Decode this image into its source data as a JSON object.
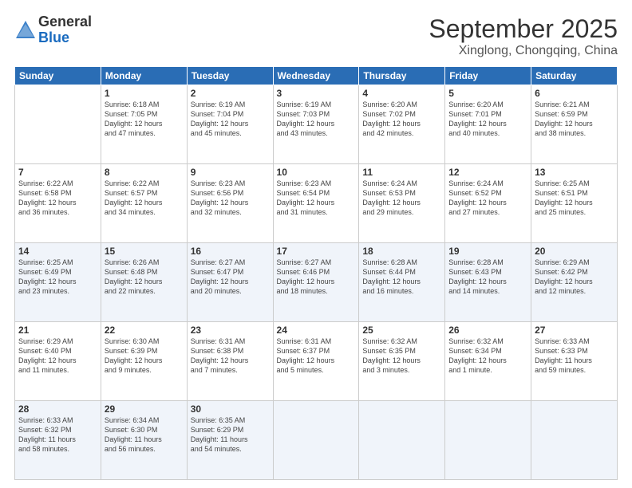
{
  "header": {
    "logo_general": "General",
    "logo_blue": "Blue",
    "month": "September 2025",
    "location": "Xinglong, Chongqing, China"
  },
  "days_of_week": [
    "Sunday",
    "Monday",
    "Tuesday",
    "Wednesday",
    "Thursday",
    "Friday",
    "Saturday"
  ],
  "weeks": [
    [
      {
        "day": "",
        "info": ""
      },
      {
        "day": "1",
        "info": "Sunrise: 6:18 AM\nSunset: 7:05 PM\nDaylight: 12 hours\nand 47 minutes."
      },
      {
        "day": "2",
        "info": "Sunrise: 6:19 AM\nSunset: 7:04 PM\nDaylight: 12 hours\nand 45 minutes."
      },
      {
        "day": "3",
        "info": "Sunrise: 6:19 AM\nSunset: 7:03 PM\nDaylight: 12 hours\nand 43 minutes."
      },
      {
        "day": "4",
        "info": "Sunrise: 6:20 AM\nSunset: 7:02 PM\nDaylight: 12 hours\nand 42 minutes."
      },
      {
        "day": "5",
        "info": "Sunrise: 6:20 AM\nSunset: 7:01 PM\nDaylight: 12 hours\nand 40 minutes."
      },
      {
        "day": "6",
        "info": "Sunrise: 6:21 AM\nSunset: 6:59 PM\nDaylight: 12 hours\nand 38 minutes."
      }
    ],
    [
      {
        "day": "7",
        "info": "Sunrise: 6:22 AM\nSunset: 6:58 PM\nDaylight: 12 hours\nand 36 minutes."
      },
      {
        "day": "8",
        "info": "Sunrise: 6:22 AM\nSunset: 6:57 PM\nDaylight: 12 hours\nand 34 minutes."
      },
      {
        "day": "9",
        "info": "Sunrise: 6:23 AM\nSunset: 6:56 PM\nDaylight: 12 hours\nand 32 minutes."
      },
      {
        "day": "10",
        "info": "Sunrise: 6:23 AM\nSunset: 6:54 PM\nDaylight: 12 hours\nand 31 minutes."
      },
      {
        "day": "11",
        "info": "Sunrise: 6:24 AM\nSunset: 6:53 PM\nDaylight: 12 hours\nand 29 minutes."
      },
      {
        "day": "12",
        "info": "Sunrise: 6:24 AM\nSunset: 6:52 PM\nDaylight: 12 hours\nand 27 minutes."
      },
      {
        "day": "13",
        "info": "Sunrise: 6:25 AM\nSunset: 6:51 PM\nDaylight: 12 hours\nand 25 minutes."
      }
    ],
    [
      {
        "day": "14",
        "info": "Sunrise: 6:25 AM\nSunset: 6:49 PM\nDaylight: 12 hours\nand 23 minutes."
      },
      {
        "day": "15",
        "info": "Sunrise: 6:26 AM\nSunset: 6:48 PM\nDaylight: 12 hours\nand 22 minutes."
      },
      {
        "day": "16",
        "info": "Sunrise: 6:27 AM\nSunset: 6:47 PM\nDaylight: 12 hours\nand 20 minutes."
      },
      {
        "day": "17",
        "info": "Sunrise: 6:27 AM\nSunset: 6:46 PM\nDaylight: 12 hours\nand 18 minutes."
      },
      {
        "day": "18",
        "info": "Sunrise: 6:28 AM\nSunset: 6:44 PM\nDaylight: 12 hours\nand 16 minutes."
      },
      {
        "day": "19",
        "info": "Sunrise: 6:28 AM\nSunset: 6:43 PM\nDaylight: 12 hours\nand 14 minutes."
      },
      {
        "day": "20",
        "info": "Sunrise: 6:29 AM\nSunset: 6:42 PM\nDaylight: 12 hours\nand 12 minutes."
      }
    ],
    [
      {
        "day": "21",
        "info": "Sunrise: 6:29 AM\nSunset: 6:40 PM\nDaylight: 12 hours\nand 11 minutes."
      },
      {
        "day": "22",
        "info": "Sunrise: 6:30 AM\nSunset: 6:39 PM\nDaylight: 12 hours\nand 9 minutes."
      },
      {
        "day": "23",
        "info": "Sunrise: 6:31 AM\nSunset: 6:38 PM\nDaylight: 12 hours\nand 7 minutes."
      },
      {
        "day": "24",
        "info": "Sunrise: 6:31 AM\nSunset: 6:37 PM\nDaylight: 12 hours\nand 5 minutes."
      },
      {
        "day": "25",
        "info": "Sunrise: 6:32 AM\nSunset: 6:35 PM\nDaylight: 12 hours\nand 3 minutes."
      },
      {
        "day": "26",
        "info": "Sunrise: 6:32 AM\nSunset: 6:34 PM\nDaylight: 12 hours\nand 1 minute."
      },
      {
        "day": "27",
        "info": "Sunrise: 6:33 AM\nSunset: 6:33 PM\nDaylight: 11 hours\nand 59 minutes."
      }
    ],
    [
      {
        "day": "28",
        "info": "Sunrise: 6:33 AM\nSunset: 6:32 PM\nDaylight: 11 hours\nand 58 minutes."
      },
      {
        "day": "29",
        "info": "Sunrise: 6:34 AM\nSunset: 6:30 PM\nDaylight: 11 hours\nand 56 minutes."
      },
      {
        "day": "30",
        "info": "Sunrise: 6:35 AM\nSunset: 6:29 PM\nDaylight: 11 hours\nand 54 minutes."
      },
      {
        "day": "",
        "info": ""
      },
      {
        "day": "",
        "info": ""
      },
      {
        "day": "",
        "info": ""
      },
      {
        "day": "",
        "info": ""
      }
    ]
  ]
}
